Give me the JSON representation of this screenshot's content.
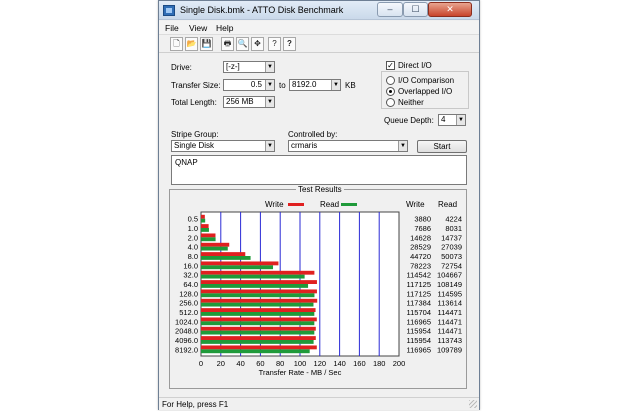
{
  "window": {
    "title": "Single Disk.bmk - ATTO Disk Benchmark"
  },
  "title_buttons": {
    "minimize": "–",
    "maximize": "☐",
    "close": "✕"
  },
  "menu": [
    "File",
    "View",
    "Help"
  ],
  "toolbar": {
    "icons": [
      "new-icon",
      "open-icon",
      "save-icon",
      "print-icon",
      "print-preview-icon",
      "move-icon",
      "help-icon",
      "context-help-icon"
    ],
    "glyphs": [
      "🗋",
      "📂",
      "💾",
      "🖶",
      "🔍",
      "✥",
      "?",
      "?"
    ]
  },
  "form": {
    "drive_label": "Drive:",
    "drive_value": "[-z-]",
    "transfer_size_label": "Transfer Size:",
    "transfer_from": "0.5",
    "transfer_to_label": "to",
    "transfer_to": "8192.0",
    "transfer_unit": "KB",
    "total_length_label": "Total Length:",
    "total_length_value": "256 MB",
    "direct_io_label": "Direct I/O",
    "direct_io_checked": true,
    "io_comparison_label": "I/O Comparison",
    "overlapped_io_label": "Overlapped I/O",
    "neither_label": "Neither",
    "selected_mode": "Overlapped I/O",
    "queue_depth_label": "Queue Depth:",
    "queue_depth_value": "4",
    "stripe_group_label": "Stripe Group:",
    "stripe_group_value": "Single Disk",
    "controlled_by_label": "Controlled by:",
    "controlled_by_value": "crmaris",
    "start_button": "Start",
    "notes_text": "QNAP"
  },
  "results": {
    "title": "Test Results",
    "legend_write": "Write",
    "legend_read": "Read",
    "col_write": "Write",
    "col_read": "Read",
    "write_color": "#e02020",
    "read_color": "#1f9a3a",
    "grid_color": "#2a2ad6"
  },
  "chart_data": {
    "type": "bar",
    "orientation": "horizontal",
    "title": "Test Results",
    "xlabel": "Transfer Rate - MB / Sec",
    "xlim": [
      0,
      200
    ],
    "xticks": [
      0,
      20,
      40,
      60,
      80,
      100,
      120,
      140,
      160,
      180,
      200
    ],
    "categories": [
      "0.5",
      "1.0",
      "2.0",
      "4.0",
      "8.0",
      "16.0",
      "32.0",
      "64.0",
      "128.0",
      "256.0",
      "512.0",
      "1024.0",
      "2048.0",
      "4096.0",
      "8192.0"
    ],
    "series": [
      {
        "name": "Write",
        "color": "#e02020",
        "values": [
          3880,
          7686,
          14628,
          28529,
          44720,
          78223,
          114542,
          117125,
          117125,
          117384,
          115704,
          116965,
          115954,
          115954,
          116965
        ]
      },
      {
        "name": "Read",
        "color": "#1f9a3a",
        "values": [
          4224,
          8031,
          14737,
          27039,
          50073,
          72754,
          104667,
          108149,
          114595,
          113614,
          114471,
          114471,
          114471,
          113743,
          109789
        ]
      }
    ]
  },
  "status": {
    "text": "For Help, press F1"
  }
}
